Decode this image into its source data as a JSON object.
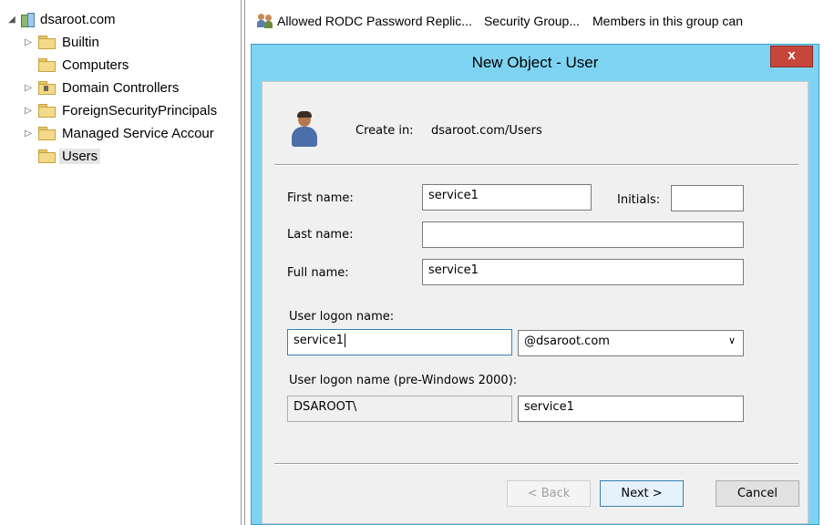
{
  "tree": {
    "root": "dsaroot.com",
    "items": [
      {
        "label": "Builtin",
        "expandable": true
      },
      {
        "label": "Computers",
        "expandable": false
      },
      {
        "label": "Domain Controllers",
        "expandable": true
      },
      {
        "label": "ForeignSecurityPrincipals",
        "expandable": true
      },
      {
        "label": "Managed Service Accour",
        "expandable": true
      },
      {
        "label": "Users",
        "expandable": false,
        "selected": true
      }
    ]
  },
  "list_row": {
    "name": "Allowed RODC Password Replic...",
    "type": "Security Group...",
    "description": "Members in this group can"
  },
  "dialog": {
    "title": "New Object - User",
    "close_label": "x",
    "create_in_label": "Create in:",
    "create_in_value": "dsaroot.com/Users",
    "first_name_label": "First name:",
    "first_name_value": "service1",
    "initials_label": "Initials:",
    "initials_value": "",
    "last_name_label": "Last name:",
    "last_name_value": "",
    "full_name_label": "Full name:",
    "full_name_value": "service1",
    "logon_name_label": "User logon name:",
    "logon_name_value": "service1",
    "domain_suffix": "@dsaroot.com",
    "pre2000_label": "User logon name (pre-Windows 2000):",
    "pre2000_domain": "DSAROOT\\",
    "pre2000_user": "service1",
    "back_label": "< Back",
    "next_label": "Next >",
    "cancel_label": "Cancel"
  }
}
